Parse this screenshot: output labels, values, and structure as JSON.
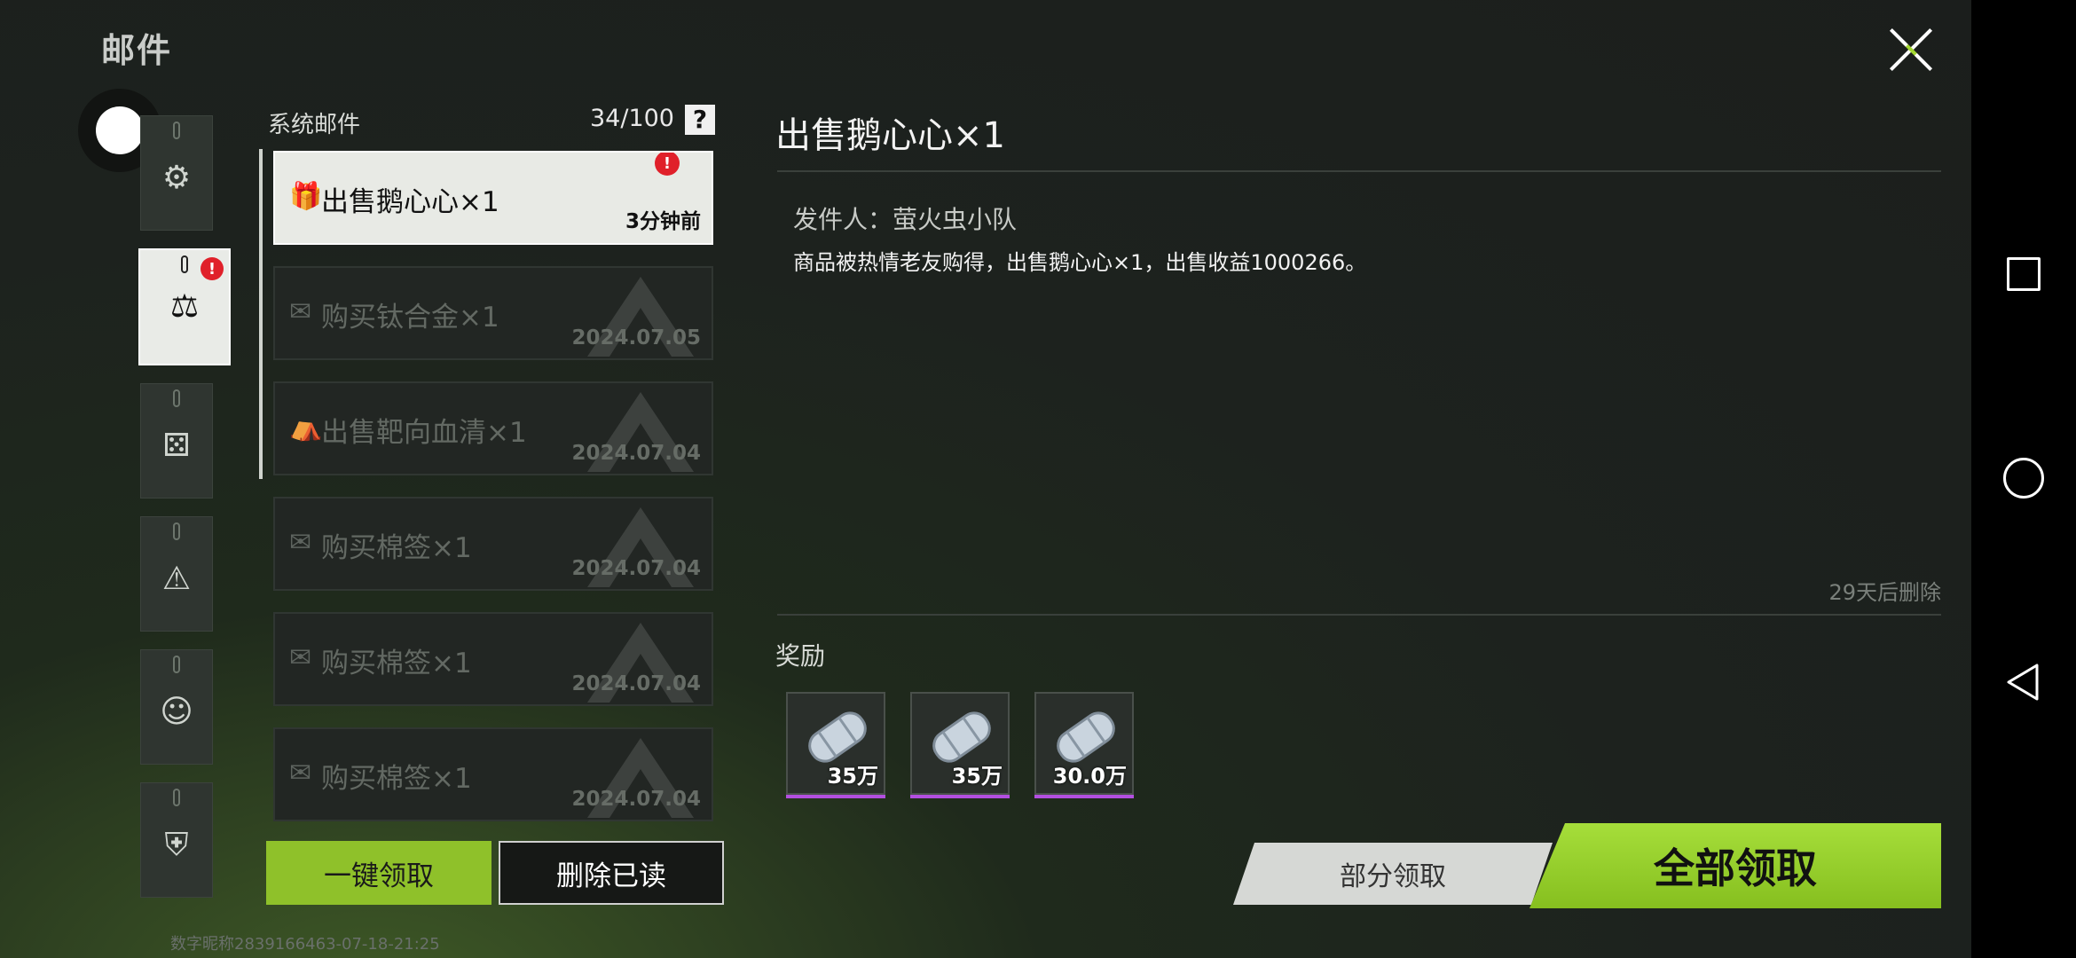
{
  "app": {
    "title": "邮件"
  },
  "list": {
    "title": "系统邮件",
    "count": "34/100",
    "help": "?"
  },
  "mails": [
    {
      "title": "出售鹅心心×1",
      "time": "3分钟前",
      "icon": "gift-icon",
      "selected": true,
      "unread": true
    },
    {
      "title": "购买钛合金×1",
      "time": "2024.07.05",
      "icon": "envelope-icon"
    },
    {
      "title": "出售靶向血清×1",
      "time": "2024.07.04",
      "icon": "shop-icon"
    },
    {
      "title": "购买棉签×1",
      "time": "2024.07.04",
      "icon": "envelope-icon"
    },
    {
      "title": "购买棉签×1",
      "time": "2024.07.04",
      "icon": "envelope-icon"
    },
    {
      "title": "购买棉签×1",
      "time": "2024.07.04",
      "icon": "envelope-icon"
    }
  ],
  "detail": {
    "title": "出售鹅心心×1",
    "sender": "发件人：萤火虫小队",
    "body": "商品被热情老友购得，出售鹅心心×1，出售收益1000266。",
    "expire": "29天后删除",
    "rewards_label": "奖励",
    "rewards": [
      {
        "amount": "35万",
        "icon": "cash-roll-icon"
      },
      {
        "amount": "35万",
        "icon": "cash-roll-icon"
      },
      {
        "amount": "30.0万",
        "icon": "cash-roll-icon"
      }
    ]
  },
  "buttons": {
    "claim_all_list": "一键领取",
    "delete_read": "删除已读",
    "partial_claim": "部分领取",
    "claim_all": "全部领取"
  },
  "footer": {
    "id_text": "数字昵称2839166463-07-18-21:25"
  },
  "colors": {
    "accent_green": "#8fc12a",
    "badge_red": "#e0202a",
    "reward_rarity": "#b34fe0"
  }
}
